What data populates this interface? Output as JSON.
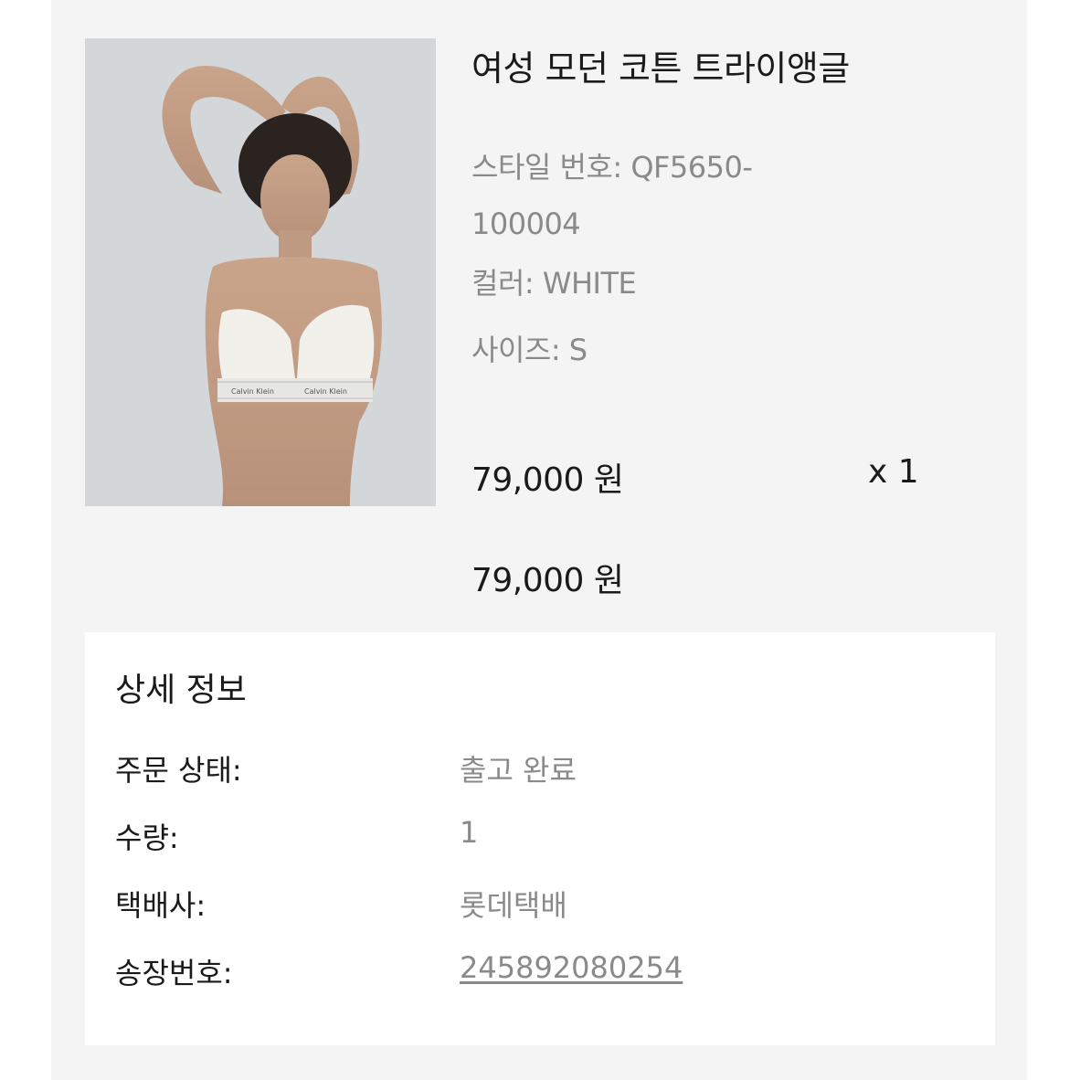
{
  "product": {
    "image_alt": "Calvin Klein modern cotton triangle bra, white",
    "image_band_text": "Calvin Klein",
    "title": "여성 모던 코튼 트라이앵글",
    "style_no": "스타일 번호: QF5650-100004",
    "color": "컬러: WHITE",
    "size": "사이즈: S",
    "unit_price": "79,000 원",
    "quantity": "x 1",
    "total_price": "79,000 원"
  },
  "details": {
    "heading": "상세 정보",
    "rows": [
      {
        "label": "주문 상태:",
        "value": "출고 완료"
      },
      {
        "label": "수량:",
        "value": "1"
      },
      {
        "label": "택배사:",
        "value": "롯데택배"
      },
      {
        "label": "송장번호:",
        "value": "245892080254"
      }
    ]
  },
  "colors": {
    "card_bg": "#f4f4f5",
    "text_primary": "#1a1a1a",
    "text_secondary": "#8a8a8a",
    "box_bg": "#ffffff"
  }
}
